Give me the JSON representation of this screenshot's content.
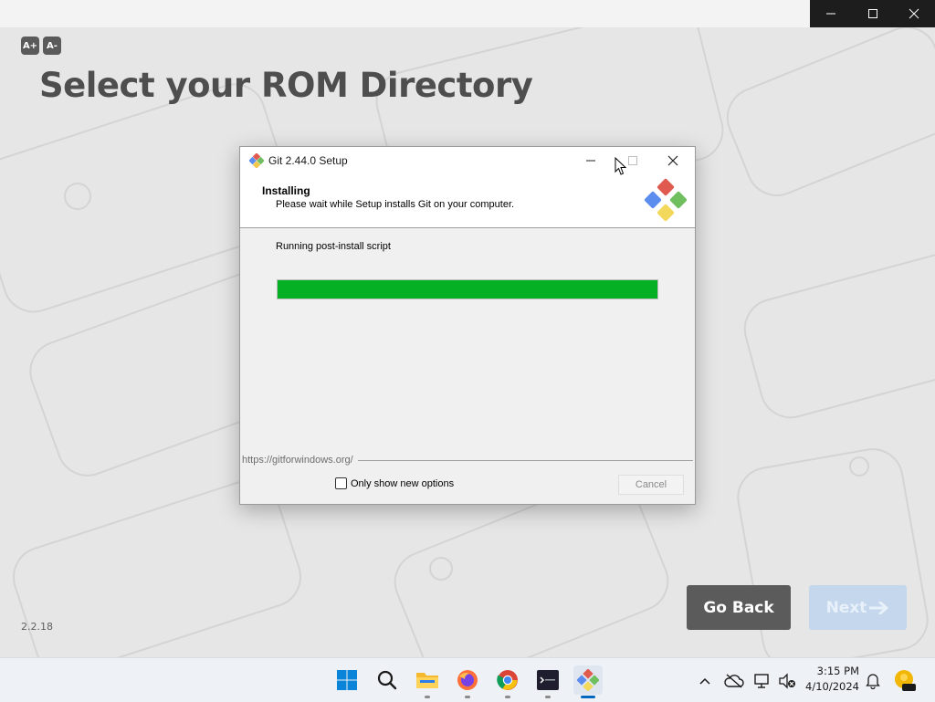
{
  "app": {
    "page_title": "Select your ROM Directory",
    "font_increase_label": "A+",
    "font_decrease_label": "A-",
    "version": "2.2.18",
    "go_back_label": "Go Back",
    "next_label": "Next"
  },
  "dialog": {
    "title": "Git 2.44.0 Setup",
    "header_title": "Installing",
    "header_subtitle": "Please wait while Setup installs Git on your computer.",
    "status_text": "Running post-install script",
    "progress_fraction": 1.0,
    "progress_color": "#06b025",
    "url_text": "https://gitforwindows.org/",
    "checkbox_label": "Only show new options",
    "checkbox_checked": false,
    "cancel_label": "Cancel"
  },
  "taskbar": {
    "apps": [
      {
        "name": "start",
        "icon": "windows-logo-icon"
      },
      {
        "name": "search",
        "icon": "search-icon"
      },
      {
        "name": "file-explorer",
        "icon": "folder-icon"
      },
      {
        "name": "firefox",
        "icon": "firefox-icon"
      },
      {
        "name": "chrome",
        "icon": "chrome-icon"
      },
      {
        "name": "terminal",
        "icon": "terminal-icon"
      },
      {
        "name": "git-setup",
        "icon": "git-icon",
        "active": true
      }
    ],
    "tray": {
      "time": "3:15 PM",
      "date": "4/10/2024"
    }
  },
  "colors": {
    "accent": "#0067c0",
    "go_back_bg": "#5b5b5b",
    "next_bg_disabled": "#c4d7ec"
  }
}
